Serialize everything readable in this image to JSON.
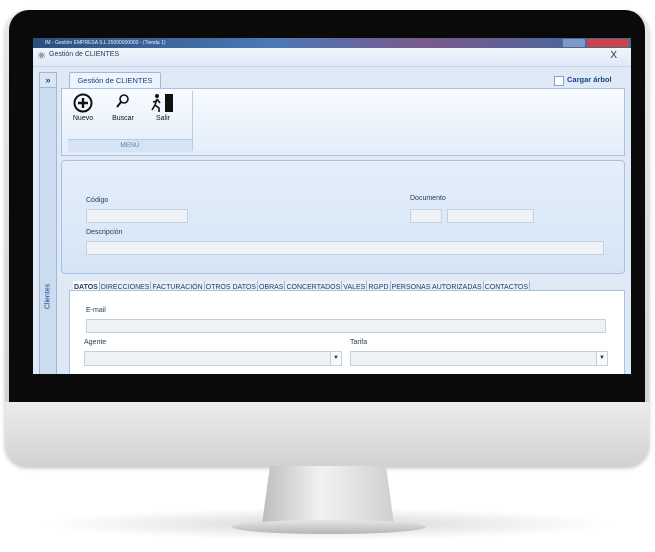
{
  "os": {
    "title": "IM - Gestión  EMPRESA S.L 25000000000 - (Tienda 1)"
  },
  "window": {
    "title": "Gestión de CLIENTES",
    "close": "X"
  },
  "sidebar": {
    "expand": "»",
    "label": "Clientes"
  },
  "tab": {
    "label": "Gestión de CLIENTES"
  },
  "tree": {
    "label": "Cargar árbol"
  },
  "ribbon": {
    "buttons": [
      {
        "label": "Nuevo",
        "icon": "plus-circle-icon"
      },
      {
        "label": "Buscar",
        "icon": "search-icon"
      },
      {
        "label": "Salir",
        "icon": "exit-door-icon"
      }
    ],
    "group": "MENÚ"
  },
  "form": {
    "codigo": "Código",
    "documento": "Documento",
    "descripcion": "Descripción"
  },
  "tabs": [
    "DATOS",
    "DIRECCIONES",
    "FACTURACIÓN",
    "OTROS DATOS",
    "OBRAS",
    "CONCERTADOS",
    "VALES",
    "RGPD",
    "PERSONAS AUTORIZADAS",
    "CONTACTOS"
  ],
  "datos": {
    "email": "E-mail",
    "agente": "Agente",
    "tarifa": "Tarifa"
  }
}
